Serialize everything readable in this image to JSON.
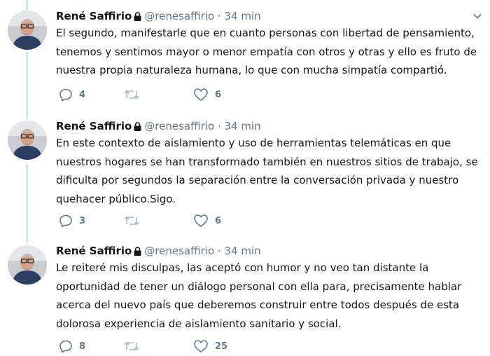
{
  "tweets": [
    {
      "author": "René Saffirio",
      "handle": "@renesaffirio",
      "separator": "·",
      "time": "34 min",
      "text": "El segundo, manifestarle que en cuanto personas con libertad de pensamiento,\ntenemos y sentimos mayor o menor empatía con otros y otras y ello es fruto de\nnuestra propia naturaleza humana, lo que con mucha simpatía compartió.",
      "replies": "4",
      "retweets": "",
      "likes": "6"
    },
    {
      "author": "René Saffirio",
      "handle": "@renesaffirio",
      "separator": "·",
      "time": "34 min",
      "text": "En este contexto de aislamiento y uso de herramientas telemáticas en que\nnuestros hogares se han transformado también en nuestros sitios de trabajo, se\ndificulta por segundos la separación entre la conversación privada y nuestro\nquehacer público.Sigo.",
      "replies": "3",
      "retweets": "",
      "likes": "6"
    },
    {
      "author": "René Saffirio",
      "handle": "@renesaffirio",
      "separator": "·",
      "time": "34 min",
      "text": "Le reiteré mis disculpas, las aceptó con humor y no veo tan distante la\noportunidad de tener un diálogo personal con ella para, precisamente hablar\nacerca del nuevo país que deberemos construir entre todos después de esta\ndolorosa experiencia de aislamiento sanitario y social.",
      "replies": "8",
      "retweets": "",
      "likes": "25"
    }
  ],
  "colors": {
    "thread_line": "#cde3ef",
    "secondary_text": "#657786",
    "primary_text": "#14171a",
    "retweet_icon": "#aab8c2"
  },
  "icons": {
    "protected": "lock-icon",
    "more": "chevron-down-icon",
    "reply": "reply-icon",
    "retweet": "retweet-icon",
    "like": "heart-icon"
  }
}
